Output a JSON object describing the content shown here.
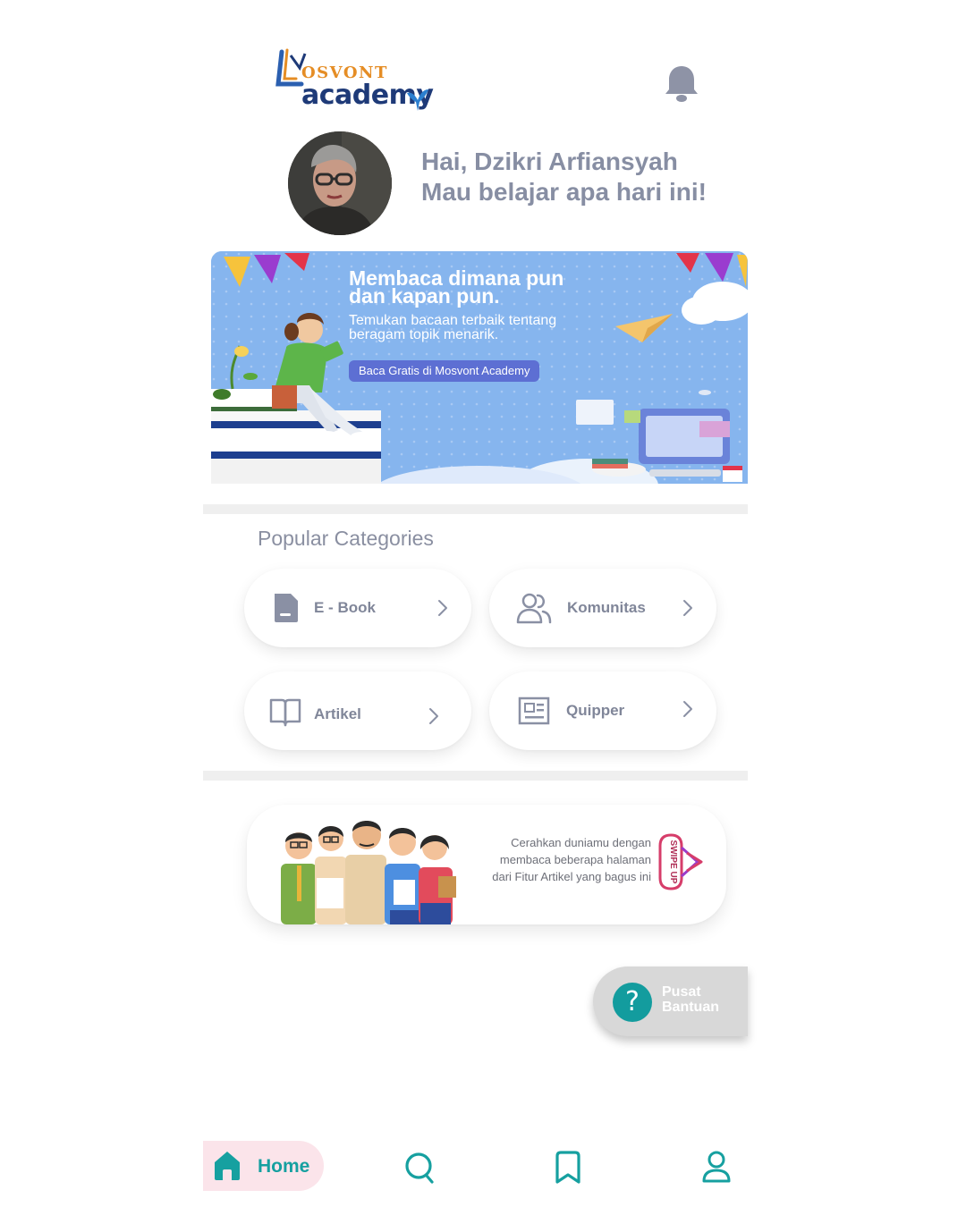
{
  "header": {
    "logo_top": "OSVONT",
    "logo_bottom": "academy"
  },
  "greeting": {
    "name_line": "Hai, Dzikri Arfiansyah",
    "sub_line": "Mau belajar apa hari ini!"
  },
  "banner": {
    "title_lines": [
      "Membaca dimana pun",
      "dan kapan pun."
    ],
    "desc_lines": [
      "Temukan bacaan terbaik tentang",
      "beragam topik menarik."
    ],
    "cta_label": "Baca Gratis di Mosvont Academy"
  },
  "categories": {
    "title": "Popular Categories",
    "items": [
      {
        "label": "E - Book",
        "icon": "file-icon"
      },
      {
        "label": "Komunitas",
        "icon": "users-icon"
      },
      {
        "label": "Artikel",
        "icon": "book-open-icon"
      },
      {
        "label": "Quipper",
        "icon": "newspaper-icon"
      }
    ]
  },
  "promo": {
    "lines": [
      "Cerahkan duniamu dengan",
      "membaca beberapa halaman",
      "dari Fitur  Artikel yang bagus ini"
    ],
    "swipe_label": "SWIPE UP"
  },
  "help": {
    "icon_glyph": "?",
    "label_lines": [
      "Pusat",
      "Bantuan"
    ]
  },
  "nav": {
    "home_label": "Home",
    "items": [
      "home-icon",
      "search-icon",
      "bookmark-icon",
      "user-icon"
    ]
  },
  "colors": {
    "accent": "#16a0a0",
    "text_muted": "#878ea3",
    "banner_bg": "#86b5ee",
    "cta_bg": "#5d6fd3",
    "home_pill": "#fbe4ea"
  }
}
